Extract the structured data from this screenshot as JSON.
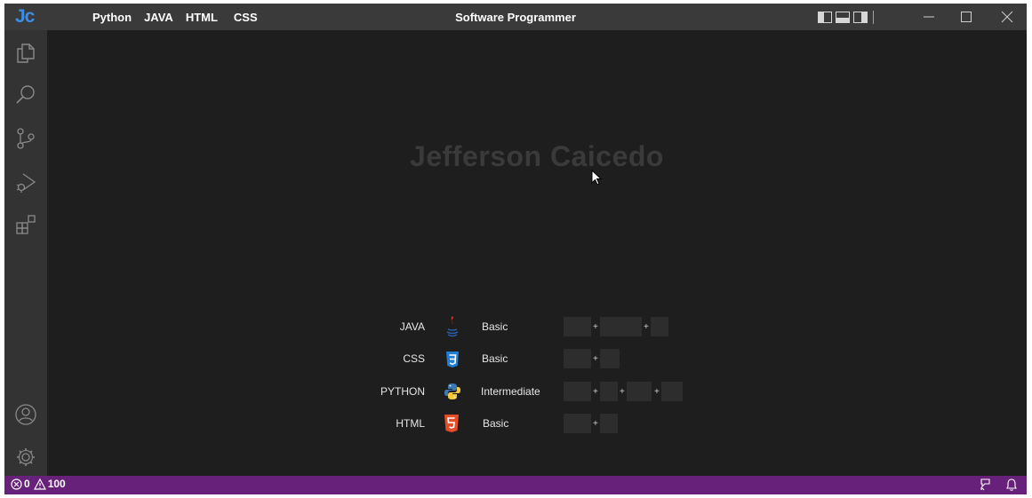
{
  "app": {
    "logo": "Jc",
    "title": "Software Programmer",
    "menu": [
      "Python",
      "JAVA",
      "HTML",
      "CSS"
    ]
  },
  "hero": {
    "name": "Jefferson Caicedo"
  },
  "skills": [
    {
      "name": "JAVA",
      "icon": "java-icon",
      "level": "Basic"
    },
    {
      "name": "CSS",
      "icon": "css3-icon",
      "level": "Basic"
    },
    {
      "name": "PYTHON",
      "icon": "python-icon",
      "level": "Intermediate"
    },
    {
      "name": "HTML",
      "icon": "html5-icon",
      "level": "Basic"
    }
  ],
  "activity_bar": [
    "explorer-icon",
    "search-icon",
    "source-control-icon",
    "run-debug-icon",
    "extensions-icon",
    "account-icon",
    "settings-gear-icon"
  ],
  "status": {
    "errors": "0",
    "warnings": "100"
  },
  "colors": {
    "accent": "#68217a",
    "logo": "#3b8ee5",
    "background": "#1e1e1e",
    "titlebar": "#3a3a3a",
    "activitybar": "#333333"
  }
}
